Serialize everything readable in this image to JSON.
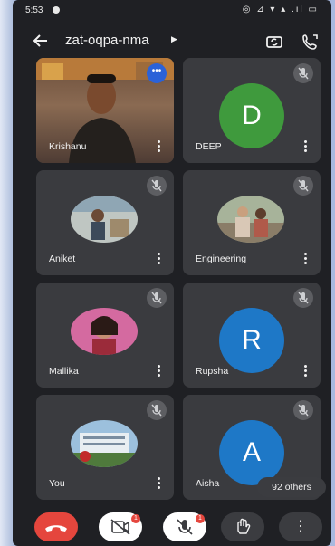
{
  "status": {
    "time": "5:53",
    "right_icons": "◎ ⊿ ▾ ▴ .ıl ▭"
  },
  "header": {
    "title": "zat-oqpa-nma"
  },
  "tiles": [
    {
      "name": "Krishanu",
      "color": "#2b62d8"
    },
    {
      "name": "DEEP",
      "letter": "D",
      "color": "#3f9a3d"
    },
    {
      "name": "Aniket"
    },
    {
      "name": "Engineering"
    },
    {
      "name": "Mallika"
    },
    {
      "name": "Rupsha",
      "letter": "R",
      "color": "#1e78c7"
    },
    {
      "name": "You"
    },
    {
      "name": "Aisha",
      "letter": "A",
      "color": "#1e78c7"
    }
  ],
  "others": {
    "label": "92 others"
  },
  "controls": {
    "badge": "1",
    "more_dots": "⋮"
  }
}
